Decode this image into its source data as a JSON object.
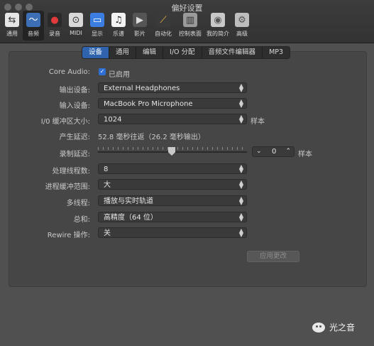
{
  "window": {
    "title": "偏好设置"
  },
  "toolbar": [
    {
      "label": "通用",
      "icon": "switch-icon",
      "glyph": "⇆",
      "bg": "#e6e6e6",
      "fg": "#333"
    },
    {
      "label": "音频",
      "icon": "waveform-icon",
      "glyph": "〜",
      "bg": "#3d6fb6",
      "fg": "#fff",
      "active": true
    },
    {
      "label": "录音",
      "icon": "record-icon",
      "glyph": "●",
      "bg": "#2a2a2a",
      "fg": "#e23b3b"
    },
    {
      "label": "MIDI",
      "icon": "midi-port-icon",
      "glyph": "⊙",
      "bg": "#d8d8d8",
      "fg": "#333"
    },
    {
      "label": "显示",
      "icon": "monitor-icon",
      "glyph": "▭",
      "bg": "#3b7de0",
      "fg": "#fff"
    },
    {
      "label": "乐谱",
      "icon": "music-note-icon",
      "glyph": "♫",
      "bg": "#f2f2f2",
      "fg": "#222"
    },
    {
      "label": "影片",
      "icon": "film-icon",
      "glyph": "▶",
      "bg": "#555",
      "fg": "#ddd"
    },
    {
      "label": "自动化",
      "icon": "automation-icon",
      "glyph": "⟋",
      "bg": "#3a3a3a",
      "fg": "#f0c040"
    },
    {
      "label": "控制表面",
      "icon": "control-surface-icon",
      "glyph": "▥",
      "bg": "#9a9a9a",
      "fg": "#333"
    },
    {
      "label": "我的简介",
      "icon": "profile-icon",
      "glyph": "◉",
      "bg": "#c8c8c8",
      "fg": "#555"
    },
    {
      "label": "高级",
      "icon": "gear-icon",
      "glyph": "⚙",
      "bg": "#bdbdbd",
      "fg": "#555"
    }
  ],
  "tabs": [
    "设备",
    "通用",
    "编辑",
    "I/O 分配",
    "音频文件编辑器",
    "MP3"
  ],
  "selected_tab": "设备",
  "settings": {
    "core_audio_label": "Core Audio:",
    "core_audio_checkbox": "已启用",
    "output_label": "输出设备:",
    "output_value": "External Headphones",
    "input_label": "输入设备:",
    "input_value": "MacBook Pro Microphone",
    "buffer_label": "I/0 缓冲区大小:",
    "buffer_value": "1024",
    "buffer_unit": "样本",
    "latency_label": "产生延迟:",
    "latency_value": "52.8 毫秒往返（26.2 毫秒输出）",
    "rec_delay_label": "录制延迟:",
    "rec_delay_value": "0",
    "rec_delay_unit": "样本",
    "threads_label": "处理线程数:",
    "threads_value": "8",
    "process_buffer_label": "进程缓冲范围:",
    "process_buffer_value": "大",
    "multithread_label": "多线程:",
    "multithread_value": "播放与实时轨道",
    "summing_label": "总和:",
    "summing_value": "高精度（64 位）",
    "rewire_label": "Rewire 操作:",
    "rewire_value": "关",
    "apply_button": "应用更改"
  },
  "watermark": {
    "text": "光之音"
  },
  "colors": {
    "accent": "#2f63ad",
    "checkbox": "#2f6fd3"
  }
}
